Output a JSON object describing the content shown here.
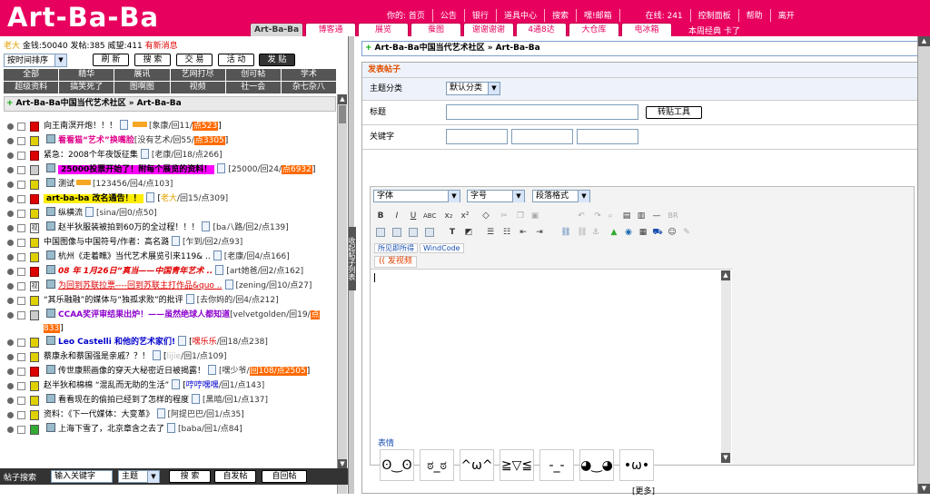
{
  "logo": "Art-Ba-Ba",
  "topnav": [
    "你的: 首页",
    "公告",
    "银行",
    "道具中心",
    "搜索",
    "嘿!邮箱"
  ],
  "online": "在线: 241",
  "topnav_right": [
    "控制面板",
    "帮助",
    "离开"
  ],
  "weekly": "本周经典 卡了",
  "site_tabs": [
    "Art-Ba-Ba",
    "博客通",
    "展览",
    "蚕图",
    "谢谢谢谢",
    "4通8达",
    "大仓库",
    "电冰箱"
  ],
  "user": {
    "name": "老大",
    "money_label": "金钱:50040",
    "posts_label": "发帖:385",
    "prestige_label": "威望:411",
    "new_msg": "有新消息"
  },
  "sort": {
    "selected": "按时间排序"
  },
  "controls": [
    "刷 新",
    "搜 索",
    "交 易",
    "活 动",
    "发 贴"
  ],
  "categories": [
    "全部",
    "精华",
    "展讯",
    "艺网打尽",
    "创可帖",
    "学术",
    "超级资料",
    "搞笑死了",
    "图啊图",
    "视频",
    "社一会",
    "杂七杂八"
  ],
  "left_breadcrumb": "Art-Ba-Ba中国当代艺术社区 » Art-Ba-Ba",
  "threads": [
    {
      "icon": "lock",
      "title": "向王南溟开炮！！！",
      "meta": "[象康/回11/",
      "hot": "点523",
      "end": "]"
    },
    {
      "icon": "yel",
      "title": "看看猫“艺术”换嘴脸",
      "meta": "[没有艺术/回55/",
      "hot": "点3305",
      "end": "]"
    },
    {
      "icon": "red",
      "title": "紧急：2008个年夜饭征集",
      "meta": "[老康/回18/点266]"
    },
    {
      "icon": "gray",
      "title": "25000投票开始了！附每个展览的资料！",
      "meta": "[25000/回24/",
      "hot": "点6932",
      "end": "]"
    },
    {
      "icon": "yel",
      "title": "测试",
      "meta": "[123456/回4/点103]"
    },
    {
      "icon": "red",
      "title": "art-ba-ba 改名通告！！",
      "author": "老大",
      "meta": "/回15/点309]"
    },
    {
      "icon": "yel",
      "title": "纵横流",
      "meta": "[sina/回0/点50]"
    },
    {
      "icon": "txt",
      "title": "赵半狄服装被拍到60万的全过程！！！",
      "meta": "[ba八路/回2/点139]"
    },
    {
      "icon": "yel",
      "title": "中国图像与中国符号/作者：高名潞",
      "meta": "[乍到/回2/点93]"
    },
    {
      "icon": "yel",
      "title": "杭州《走着瞧》当代艺术展览引来119& ..",
      "meta": "[老康/回4/点166]"
    },
    {
      "icon": "red",
      "title": "08 年 1月26日“真当——中国青年艺术 ..",
      "meta": "[art她爸/回2/点162]"
    },
    {
      "icon": "txt",
      "title": "为回到苏联拉票----回到苏联主打作品&quo ..",
      "meta": "[zening/回10/点27]"
    },
    {
      "icon": "yel",
      "title": "“其乐融融”的媒体与“独孤求败”的批评",
      "meta": "[去你妈的/回4/点212]"
    },
    {
      "icon": "gray",
      "title": "CCAA奖评审结果出炉！——虽然绝球人都知道",
      "meta": "[velvetgolden/回19/",
      "hot": "点833",
      "end": "]"
    },
    {
      "icon": "yel",
      "title": "Leo Castelli 和他的艺术家们!",
      "author": "嘿乐乐",
      "meta": "/回18/点238]"
    },
    {
      "icon": "yel",
      "title": "蔡康永和蔡国强是亲戚？？！",
      "author": "lijie",
      "meta": "/回1/点109]"
    },
    {
      "icon": "red",
      "title": "传世康熙画像的穿天大秘密近日被揭露！",
      "meta": "[嘿少爷/",
      "hot": "回108/点2505",
      "end": "]"
    },
    {
      "icon": "yel",
      "title": "赵半狄和棉棉 “混乱而无助的生活”",
      "author": "哼哼嘿嘿",
      "meta": "/回1/点143]"
    },
    {
      "icon": "yel",
      "title": "看看现在的偷拍已经到了怎样的程度",
      "meta": "[黑暗/回1/点137]"
    },
    {
      "icon": "yel",
      "title": "资料：《下一代媒体：大变革》",
      "meta": "[阿提巴巴/回1/点35]"
    },
    {
      "icon": "grn",
      "title": "上海下雪了，北京章含之去了",
      "meta": "[baba/回1/点84]"
    }
  ],
  "left_search": {
    "label": "帖子搜索",
    "placeholder": "输入关键字",
    "select": "主题",
    "buttons": [
      "搜 索",
      "自发帖",
      "自回帖"
    ]
  },
  "collapse_label": "收起帖子列表",
  "right_breadcrumb": "Art-Ba-Ba中国当代艺术社区 » Art-Ba-Ba",
  "form": {
    "title": "发表帖子",
    "topic_label": "主题分类",
    "topic_value": "默认分类",
    "subject_label": "标题",
    "repost_tool": "转贴工具",
    "keywords_label": "关键字",
    "font_label": "字体",
    "size_label": "字号",
    "format_label": "段落格式",
    "editor_tabs": [
      "所见即所得",
      "WindCode"
    ],
    "video_button": "发视频",
    "emotes_label": "表情",
    "more": "[更多]"
  }
}
